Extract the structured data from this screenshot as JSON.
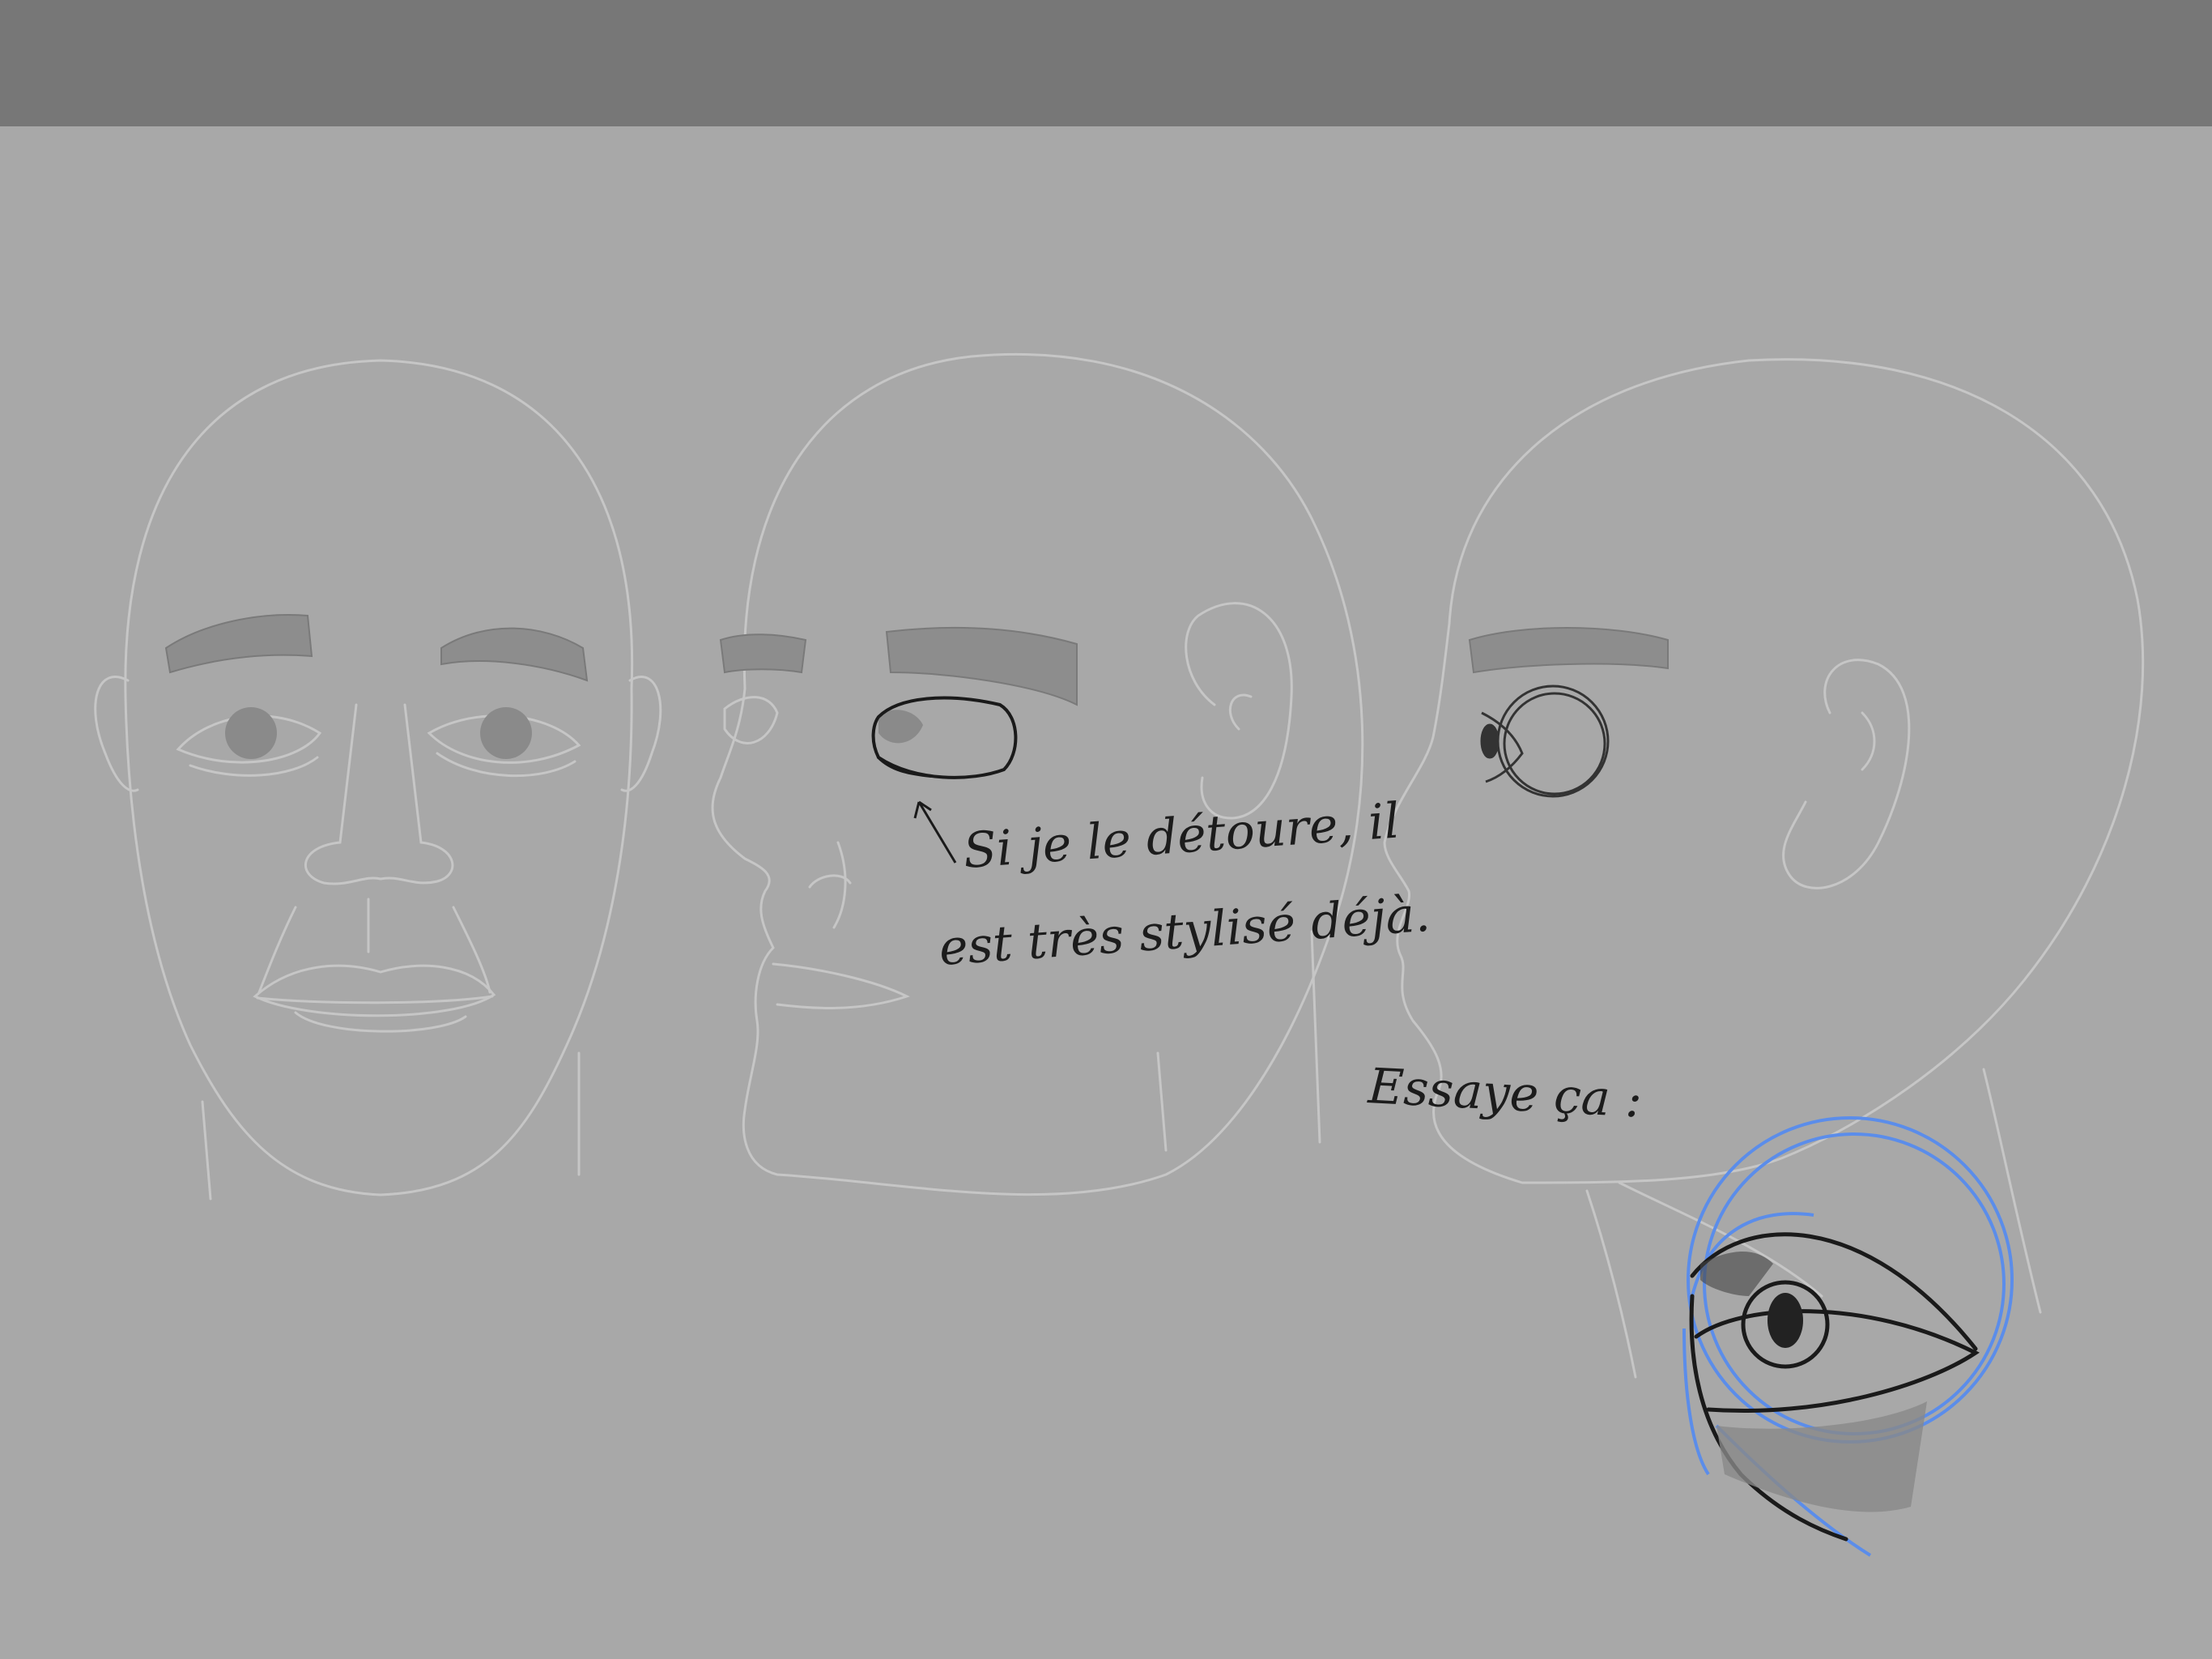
{
  "annotations": {
    "line1": "Si je le détoure, il",
    "line2": "est très stylisé déjà.",
    "line3": "Essaye ça :"
  },
  "colors": {
    "toolbar": "#777777",
    "paper": "#a8a8a8",
    "pencil_light": "#c9c9c9",
    "pencil_dark": "#1a1a1a",
    "blue_overlay": "#5b8dea"
  }
}
